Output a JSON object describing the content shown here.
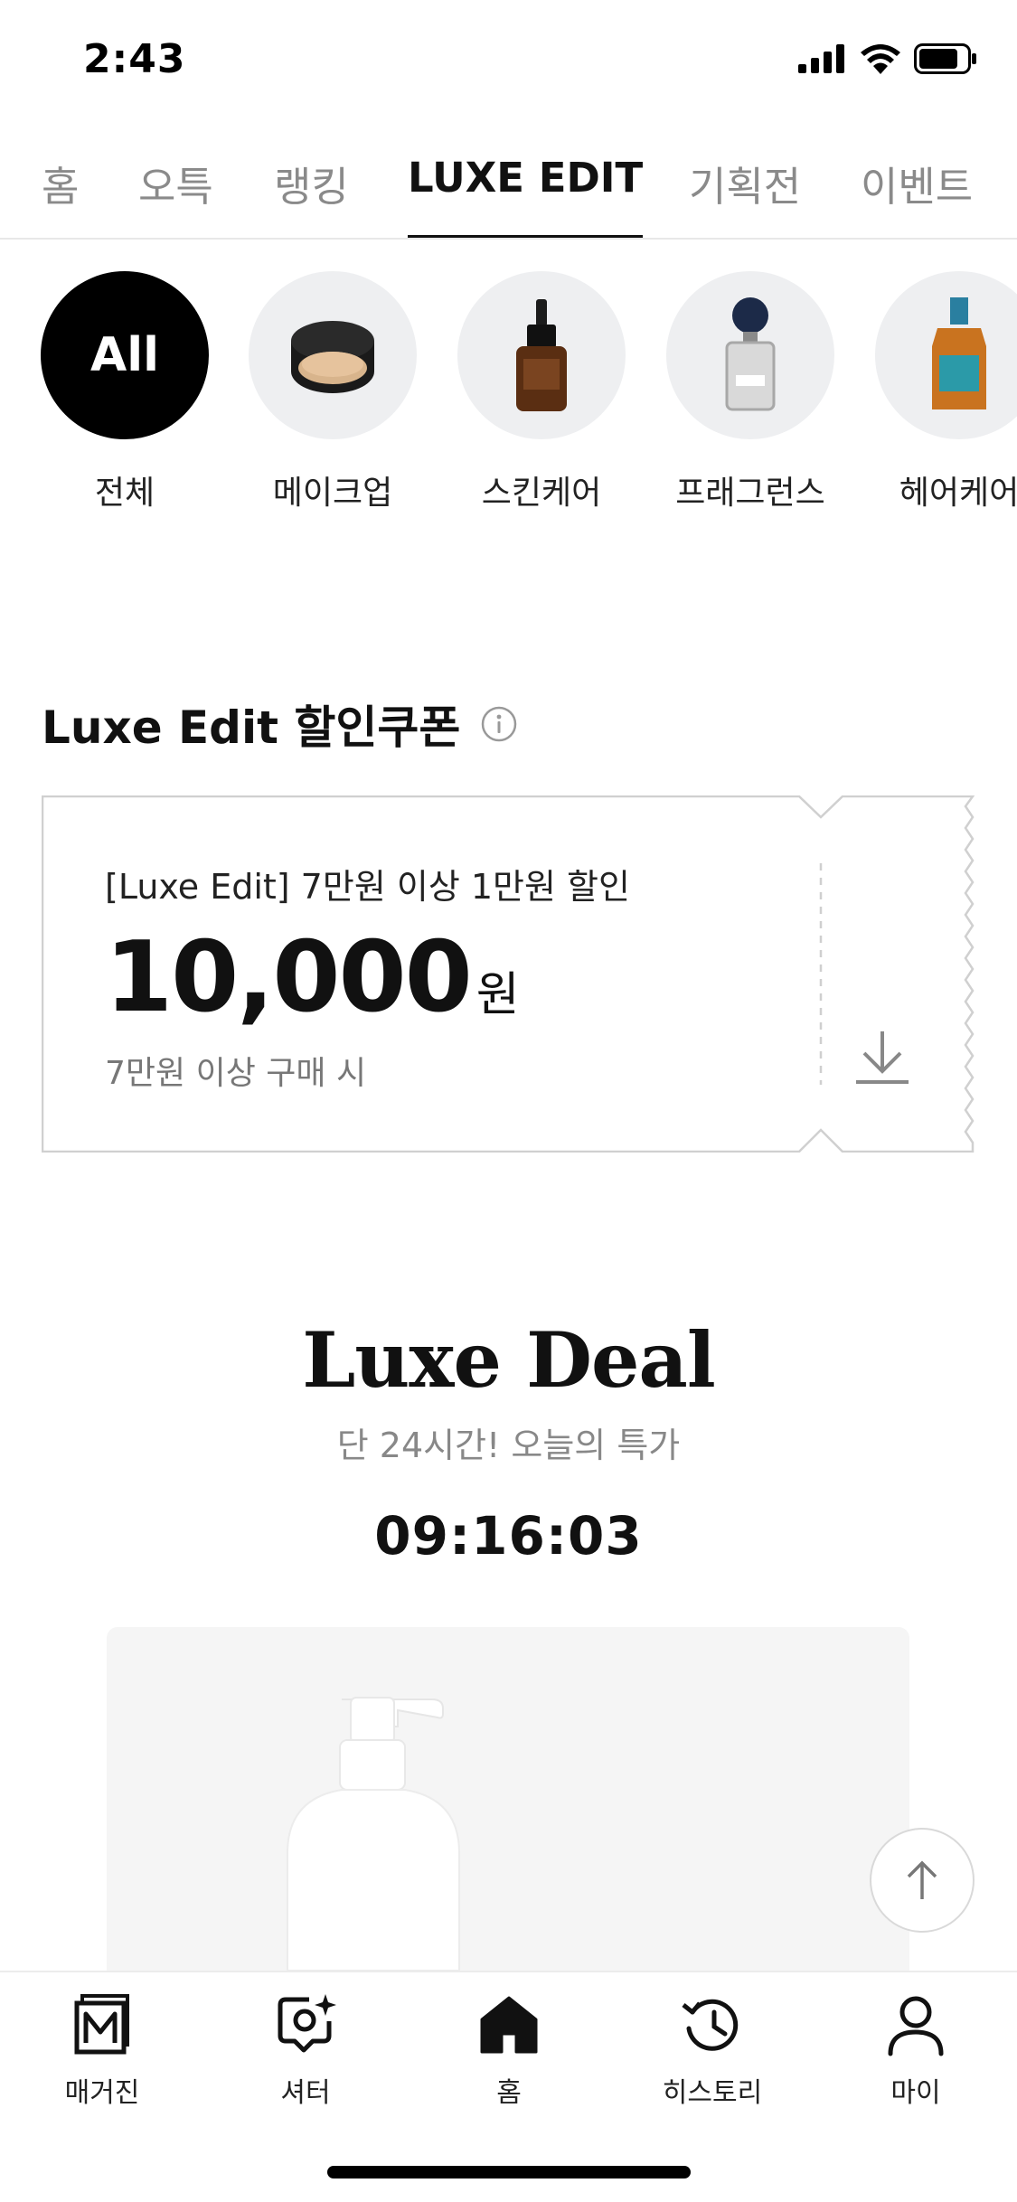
{
  "status_bar": {
    "time": "2:43"
  },
  "top_tabs": [
    {
      "label": "홈",
      "active": false
    },
    {
      "label": "오특",
      "active": false
    },
    {
      "label": "랭킹",
      "active": false
    },
    {
      "label": "LUXE EDIT",
      "active": true
    },
    {
      "label": "기획전",
      "active": false
    },
    {
      "label": "이벤트",
      "active": false
    }
  ],
  "categories": [
    {
      "label": "전체",
      "circle_text": "All",
      "selected": true
    },
    {
      "label": "메이크업",
      "icon": "cushion-compact-icon"
    },
    {
      "label": "스킨케어",
      "icon": "serum-bottle-icon"
    },
    {
      "label": "프래그런스",
      "icon": "perfume-bottle-icon"
    },
    {
      "label": "헤어케어",
      "icon": "hair-oil-bottle-icon"
    }
  ],
  "coupon_section": {
    "title": "Luxe Edit 할인쿠폰",
    "coupon": {
      "name": "[Luxe Edit] 7만원 이상 1만원 할인",
      "amount": "10,000",
      "unit": "원",
      "condition": "7만원 이상 구매 시"
    }
  },
  "deal": {
    "title": "Luxe Deal",
    "subtitle": "단 24시간! 오늘의 특가",
    "timer": "09:16:03"
  },
  "bottom_nav": [
    {
      "label": "매거진",
      "icon": "magazine-icon"
    },
    {
      "label": "셔터",
      "icon": "shutter-icon"
    },
    {
      "label": "홈",
      "icon": "home-icon"
    },
    {
      "label": "히스토리",
      "icon": "history-icon"
    },
    {
      "label": "마이",
      "icon": "profile-icon"
    }
  ]
}
